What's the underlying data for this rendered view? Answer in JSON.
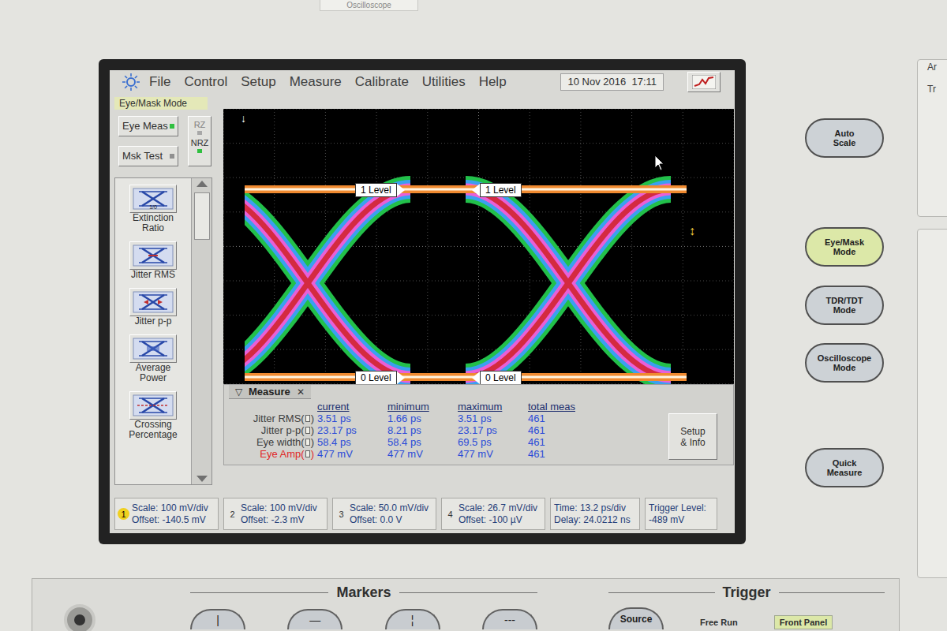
{
  "bezel": {
    "label": "Oscilloscope",
    "side_labels": [
      "Ar",
      "Tr"
    ]
  },
  "menu": {
    "items": [
      "File",
      "Control",
      "Setup",
      "Measure",
      "Calibrate",
      "Utilities",
      "Help"
    ],
    "datetime": "10 Nov 2016  17:11"
  },
  "mode_label": "Eye/Mask Mode",
  "mode_buttons": [
    {
      "label": "Eye Meas",
      "selected": true
    },
    {
      "label": "Msk Test",
      "selected": false
    }
  ],
  "format_toggle": [
    {
      "label": "RZ",
      "selected": false
    },
    {
      "label": "NRZ",
      "selected": true
    }
  ],
  "measurement_buttons": [
    {
      "lines": [
        "Extinction",
        "Ratio"
      ],
      "icon_text": "1/0"
    },
    {
      "lines": [
        "Jitter RMS"
      ],
      "icon_text": ""
    },
    {
      "lines": [
        "Jitter p-p"
      ],
      "icon_text": ""
    },
    {
      "lines": [
        "Average",
        "Power"
      ],
      "icon_text": ""
    },
    {
      "lines": [
        "Crossing",
        "Percentage"
      ],
      "icon_text": ""
    }
  ],
  "graph": {
    "top_arrow": "↓",
    "side_arrow": "↕",
    "one_level_markers": [
      "1 Level",
      "1 Level"
    ],
    "zero_level_markers": [
      "0 Level",
      "0 Level"
    ]
  },
  "measure": {
    "title": "Measure",
    "collapse": "▽",
    "close": "✕",
    "columns": [
      "current",
      "minimum",
      "maximum",
      "total meas"
    ],
    "rows": [
      {
        "name": "Jitter RMS(",
        "name_end": ")",
        "values": [
          "3.51 ps",
          "1.66 ps",
          "3.51 ps",
          "461"
        ],
        "highlighted": false
      },
      {
        "name": "Jitter p-p(",
        "name_end": ")",
        "values": [
          "23.17 ps",
          "8.21 ps",
          "23.17 ps",
          "461"
        ],
        "highlighted": false
      },
      {
        "name": "Eye width(",
        "name_end": ")",
        "values": [
          "58.4 ps",
          "58.4 ps",
          "69.5 ps",
          "461"
        ],
        "highlighted": false
      },
      {
        "name": "Eye Amp(",
        "name_end": ")",
        "values": [
          "477 mV",
          "477 mV",
          "477 mV",
          "461"
        ],
        "highlighted": true
      }
    ],
    "setup_button": [
      "Setup",
      "& Info"
    ]
  },
  "status": {
    "channels": [
      {
        "number": "1",
        "scale": "Scale: 100 mV/div",
        "offset": "Offset: -140.5 mV",
        "selected": true
      },
      {
        "number": "2",
        "scale": "Scale: 100 mV/div",
        "offset": "Offset: -2.3 mV",
        "selected": false
      },
      {
        "number": "3",
        "scale": "Scale: 50.0 mV/div",
        "offset": "Offset: 0.0 V",
        "selected": false
      },
      {
        "number": "4",
        "scale": "Scale: 26.7 mV/div",
        "offset": "Offset: -100 µV",
        "selected": false
      }
    ],
    "time": [
      "Time: 13.2 ps/div",
      "Delay: 24.0212 ns"
    ],
    "trigger": [
      "Trigger Level:",
      "-489 mV"
    ]
  },
  "front_buttons": [
    {
      "lines": [
        "Auto",
        "Scale"
      ],
      "lit": false
    },
    {
      "lines": [
        "Eye/Mask",
        "Mode"
      ],
      "lit": true
    },
    {
      "lines": [
        "TDR/TDT",
        "Mode"
      ],
      "lit": false
    },
    {
      "lines": [
        "Oscilloscope",
        "Mode"
      ],
      "lit": false
    },
    {
      "lines": [
        "Quick",
        "Measure"
      ],
      "lit": false
    }
  ],
  "markers_panel": {
    "title": "Markers",
    "buttons": [
      "|",
      "—",
      "¦",
      "---"
    ]
  },
  "trigger_panel": {
    "title": "Trigger",
    "source": "Source",
    "modes": [
      {
        "label": "Free Run",
        "lit": false
      },
      {
        "label": "Front Panel",
        "lit": true
      }
    ]
  }
}
